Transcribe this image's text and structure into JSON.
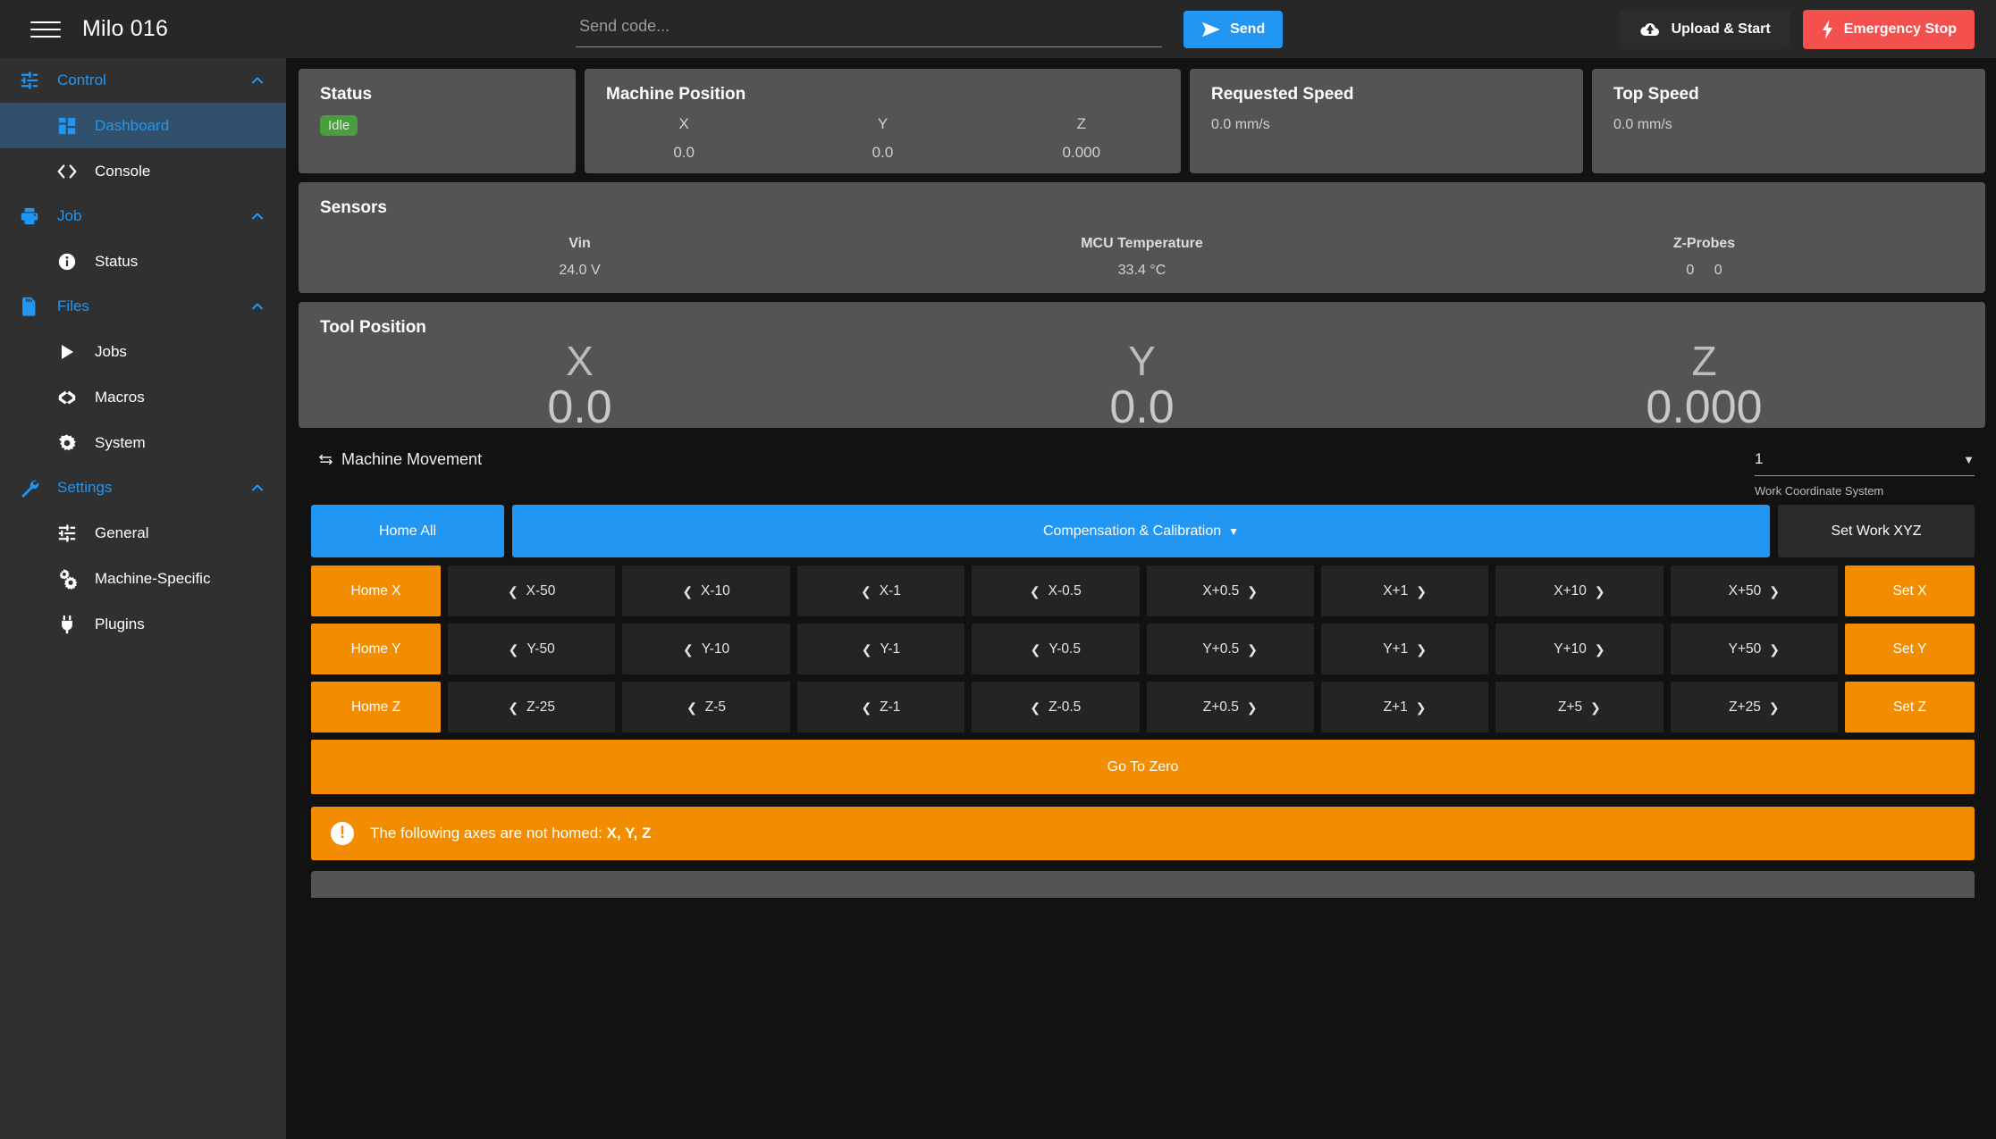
{
  "appbar": {
    "menu_icon": "hamburger-menu-icon",
    "title": "Milo 016",
    "code_input_value": "",
    "code_input_placeholder": "Send code...",
    "send_label": "Send",
    "send_icon": "send-paper-plane-icon",
    "upload_label": "Upload & Start",
    "upload_icon": "cloud-upload-icon",
    "estop_label": "Emergency Stop",
    "estop_icon": "lightning-bolt-icon",
    "accent_blue": "#2196f3",
    "danger_red": "#f4514e"
  },
  "sidebar": {
    "groups": [
      {
        "label": "Control",
        "icon": "sliders-icon",
        "expanded": true,
        "items": [
          {
            "label": "Dashboard",
            "icon": "dashboard-grid-icon",
            "active": true
          },
          {
            "label": "Console",
            "icon": "code-brackets-icon",
            "active": false
          }
        ]
      },
      {
        "label": "Job",
        "icon": "printer-icon",
        "expanded": true,
        "items": [
          {
            "label": "Status",
            "icon": "info-circle-icon",
            "active": false
          }
        ]
      },
      {
        "label": "Files",
        "icon": "sd-card-icon",
        "expanded": true,
        "items": [
          {
            "label": "Jobs",
            "icon": "play-triangle-icon",
            "active": false
          },
          {
            "label": "Macros",
            "icon": "macro-code-icon",
            "active": false
          },
          {
            "label": "System",
            "icon": "gear-icon",
            "active": false
          }
        ]
      },
      {
        "label": "Settings",
        "icon": "wrench-icon",
        "expanded": true,
        "items": [
          {
            "label": "General",
            "icon": "sliders-icon",
            "active": false
          },
          {
            "label": "Machine-Specific",
            "icon": "gears-icon",
            "active": false
          },
          {
            "label": "Plugins",
            "icon": "plug-icon",
            "active": false
          }
        ]
      }
    ]
  },
  "status_card": {
    "title": "Status",
    "badge": "Idle",
    "badge_color": "#4a9e3e"
  },
  "machine_position": {
    "title": "Machine Position",
    "axes": [
      {
        "name": "X",
        "value": "0.0"
      },
      {
        "name": "Y",
        "value": "0.0"
      },
      {
        "name": "Z",
        "value": "0.000"
      }
    ]
  },
  "requested_speed": {
    "title": "Requested Speed",
    "value": "0.0 mm/s"
  },
  "top_speed": {
    "title": "Top Speed",
    "value": "0.0 mm/s"
  },
  "sensors": {
    "title": "Sensors",
    "items": [
      {
        "name": "Vin",
        "value": "24.0 V"
      },
      {
        "name": "MCU Temperature",
        "value": "33.4 °C"
      },
      {
        "name": "Z-Probes",
        "value": "0   0",
        "value_a": "0",
        "value_b": "0"
      }
    ]
  },
  "tool_position": {
    "title": "Tool Position",
    "axes": [
      {
        "name": "X",
        "value": "0.0"
      },
      {
        "name": "Y",
        "value": "0.0"
      },
      {
        "name": "Z",
        "value": "0.000"
      }
    ]
  },
  "machine_movement": {
    "title": "Machine Movement",
    "title_icon": "swap-horizontal-icon",
    "wcs_value": "1",
    "wcs_caret_icon": "caret-down-icon",
    "wcs_hint": "Work Coordinate System",
    "home_all_label": "Home All",
    "compensation_label": "Compensation & Calibration",
    "compensation_caret_icon": "caret-down-icon",
    "set_work_label": "Set Work XYZ",
    "go_to_zero_label": "Go To Zero",
    "orange": "#f28c00",
    "rows": [
      {
        "home_label": "Home X",
        "set_label": "Set X",
        "steps": [
          {
            "label": "X-50",
            "dir": "left"
          },
          {
            "label": "X-10",
            "dir": "left"
          },
          {
            "label": "X-1",
            "dir": "left"
          },
          {
            "label": "X-0.5",
            "dir": "left"
          },
          {
            "label": "X+0.5",
            "dir": "right"
          },
          {
            "label": "X+1",
            "dir": "right"
          },
          {
            "label": "X+10",
            "dir": "right"
          },
          {
            "label": "X+50",
            "dir": "right"
          }
        ]
      },
      {
        "home_label": "Home Y",
        "set_label": "Set Y",
        "steps": [
          {
            "label": "Y-50",
            "dir": "left"
          },
          {
            "label": "Y-10",
            "dir": "left"
          },
          {
            "label": "Y-1",
            "dir": "left"
          },
          {
            "label": "Y-0.5",
            "dir": "left"
          },
          {
            "label": "Y+0.5",
            "dir": "right"
          },
          {
            "label": "Y+1",
            "dir": "right"
          },
          {
            "label": "Y+10",
            "dir": "right"
          },
          {
            "label": "Y+50",
            "dir": "right"
          }
        ]
      },
      {
        "home_label": "Home Z",
        "set_label": "Set Z",
        "steps": [
          {
            "label": "Z-25",
            "dir": "left"
          },
          {
            "label": "Z-5",
            "dir": "left"
          },
          {
            "label": "Z-1",
            "dir": "left"
          },
          {
            "label": "Z-0.5",
            "dir": "left"
          },
          {
            "label": "Z+0.5",
            "dir": "right"
          },
          {
            "label": "Z+1",
            "dir": "right"
          },
          {
            "label": "Z+5",
            "dir": "right"
          },
          {
            "label": "Z+25",
            "dir": "right"
          }
        ]
      }
    ]
  },
  "alert": {
    "icon": "exclamation-circle-icon",
    "text_prefix": "The following axes are not homed: ",
    "text_bold": "X, Y, Z",
    "color": "#f28c00"
  }
}
